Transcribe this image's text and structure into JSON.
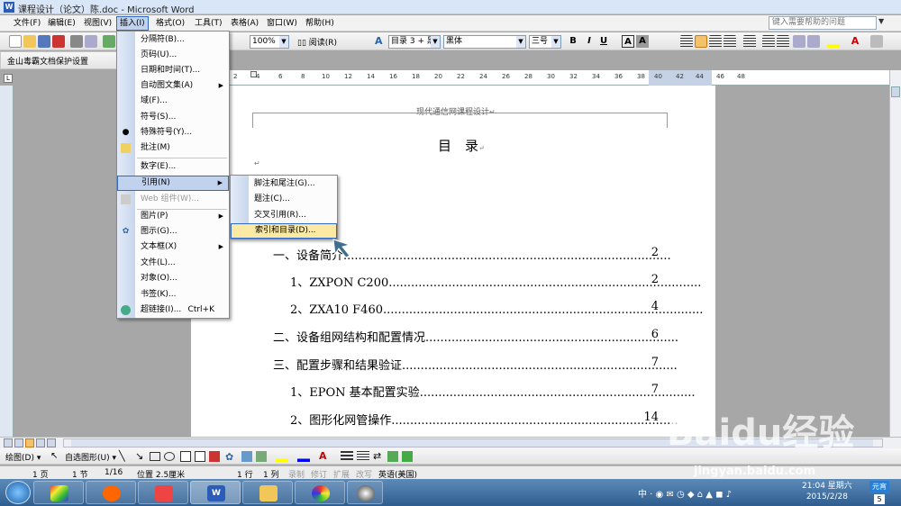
{
  "window": {
    "title": "课程设计（论文）陈.doc - Microsoft Word",
    "app_icon": "W"
  },
  "menubar": {
    "items": [
      "文件(F)",
      "编辑(E)",
      "视图(V)",
      "插入(I)",
      "格式(O)",
      "工具(T)",
      "表格(A)",
      "窗口(W)",
      "帮助(H)"
    ],
    "help_placeholder": "键入需要帮助的问题"
  },
  "toolbar": {
    "zoom": "100%",
    "reading": "阅读(R)",
    "style": "目录 3 + 黑",
    "font": "黑体",
    "size": "三号",
    "bold": "B",
    "italic": "I",
    "underline": "U",
    "char_border": "A",
    "char_shade": "A"
  },
  "toolbar2": {
    "label": "金山毒霸文档保护设置"
  },
  "insert_menu": {
    "items": [
      {
        "label": "分隔符(B)..."
      },
      {
        "label": "页码(U)..."
      },
      {
        "label": "日期和时间(T)..."
      },
      {
        "label": "自动图文集(A)"
      },
      {
        "label": "域(F)..."
      },
      {
        "label": "符号(S)..."
      },
      {
        "label": "特殊符号(Y)..."
      },
      {
        "label": "批注(M)"
      },
      {
        "label": "数字(E)..."
      },
      {
        "label": "引用(N)"
      },
      {
        "label": "Web 组件(W)..."
      },
      {
        "label": "图片(P)"
      },
      {
        "label": "图示(G)..."
      },
      {
        "label": "文本框(X)"
      },
      {
        "label": "文件(L)..."
      },
      {
        "label": "对象(O)..."
      },
      {
        "label": "书签(K)..."
      },
      {
        "label": "超链接(I)..."
      }
    ],
    "hyperlink_shortcut": "Ctrl+K"
  },
  "reference_submenu": {
    "items": [
      {
        "label": "脚注和尾注(G)..."
      },
      {
        "label": "题注(C)..."
      },
      {
        "label": "交叉引用(R)..."
      },
      {
        "label": "索引和目录(D)..."
      }
    ]
  },
  "ruler": {
    "numbers": [
      "2",
      "4",
      "6",
      "8",
      "10",
      "12",
      "14",
      "16",
      "18",
      "20",
      "22",
      "24",
      "26",
      "28",
      "30",
      "32",
      "34",
      "36",
      "38",
      "40",
      "42",
      "44",
      "46",
      "48"
    ]
  },
  "document": {
    "header": "现代通信网课程设计",
    "toc_title": "目　录",
    "toc": [
      {
        "text": "一、设备简介",
        "page": "2"
      },
      {
        "text": "1、ZXPON C200",
        "page": "2"
      },
      {
        "text": "2、ZXA10 F460",
        "page": "4"
      },
      {
        "text": "二、设备组网结构和配置情况",
        "page": "6"
      },
      {
        "text": "三、配置步骤和结果验证",
        "page": "7"
      },
      {
        "text": "1、EPON 基本配置实验",
        "page": "7"
      },
      {
        "text": "2、图形化网管操作",
        "page": "14"
      }
    ]
  },
  "drawbar": {
    "draw": "绘图(D)",
    "autoshapes": "自选图形(U)"
  },
  "status": {
    "page": "1 页",
    "section": "1 节",
    "pages": "1/16",
    "position": "位置 2.5厘米",
    "line": "1 行",
    "col": "1 列",
    "rec": "录制",
    "trk": "修订",
    "ext": "扩展",
    "ovr": "改写",
    "lang": "英语(美国)"
  },
  "taskbar": {
    "time": "21:04 星期六",
    "date": "2015/2/28",
    "ime": "中",
    "ime_badge": "元宵",
    "badge_num": "5"
  },
  "watermark": {
    "text": "Baidu经验",
    "url": "jingyan.baidu.com"
  }
}
